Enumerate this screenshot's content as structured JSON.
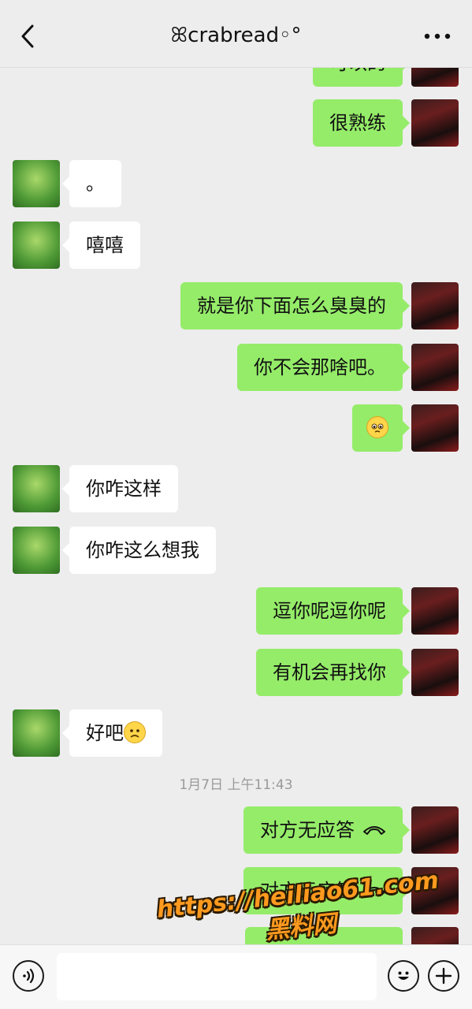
{
  "header": {
    "title": "ꕤcrabread◦°",
    "back_icon": "chevron-left-icon",
    "more_icon": "more-dots-icon"
  },
  "messages": [
    {
      "from": "me",
      "text": "可以的"
    },
    {
      "from": "me",
      "text": "很熟练"
    },
    {
      "from": "them",
      "text": "。"
    },
    {
      "from": "them",
      "text": "嘻嘻"
    },
    {
      "from": "me",
      "text": "就是你下面怎么臭臭的"
    },
    {
      "from": "me",
      "text": "你不会那啥吧。"
    },
    {
      "from": "me",
      "text": "",
      "emoji": "pleading-face-emoji"
    },
    {
      "from": "them",
      "text": "你咋这样"
    },
    {
      "from": "them",
      "text": "你咋这么想我"
    },
    {
      "from": "me",
      "text": "逗你呢逗你呢"
    },
    {
      "from": "me",
      "text": "有机会再找你"
    },
    {
      "from": "them",
      "text": "好吧",
      "emoji": "frown-face-emoji"
    },
    {
      "from": "me",
      "text": "对方无应答",
      "icon": "phone-hangup-icon"
    },
    {
      "from": "me",
      "text": "对方无应答",
      "icon": "phone-hangup-icon"
    }
  ],
  "timestamp": "1月7日 上午11:43",
  "input_bar": {
    "voice_icon": "voice-icon",
    "input_value": "",
    "emoji_icon": "emoji-icon",
    "plus_icon": "plus-icon"
  },
  "watermark": {
    "url": "https://heiliao61.com",
    "name": "黑料网"
  },
  "colors": {
    "background": "#ededed",
    "my_bubble": "#95ec69",
    "their_bubble": "#ffffff",
    "watermark": "#ff9a1f"
  }
}
